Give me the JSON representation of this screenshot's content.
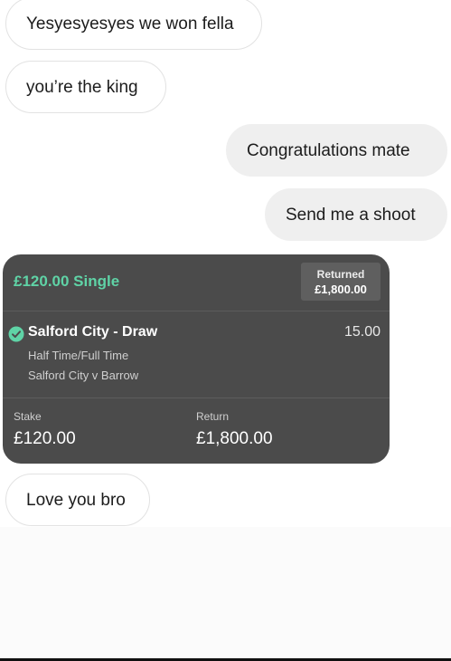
{
  "messages": [
    {
      "text": "Yesyesyesyes we won fella",
      "direction": "incoming"
    },
    {
      "text": "you’re the king",
      "direction": "incoming"
    },
    {
      "text": "Congratulations mate",
      "direction": "outgoing"
    },
    {
      "text": "Send me a shoot",
      "direction": "outgoing"
    },
    {
      "text": "Love you bro",
      "direction": "incoming"
    }
  ],
  "bet_slip": {
    "title": "£120.00 Single",
    "returned_label": "Returned",
    "returned_amount": "£1,800.00",
    "selection": {
      "status_icon": "check-circle-icon",
      "name": "Salford City - Draw",
      "odds": "15.00",
      "market": "Half Time/Full Time",
      "event": "Salford City v Barrow"
    },
    "stake_label": "Stake",
    "stake_value": "£120.00",
    "return_label": "Return",
    "return_value": "£1,800.00"
  },
  "colors": {
    "accent_green": "#5fd3a6",
    "card_background": "#4b4b4b",
    "outgoing_bubble": "#efefef"
  }
}
